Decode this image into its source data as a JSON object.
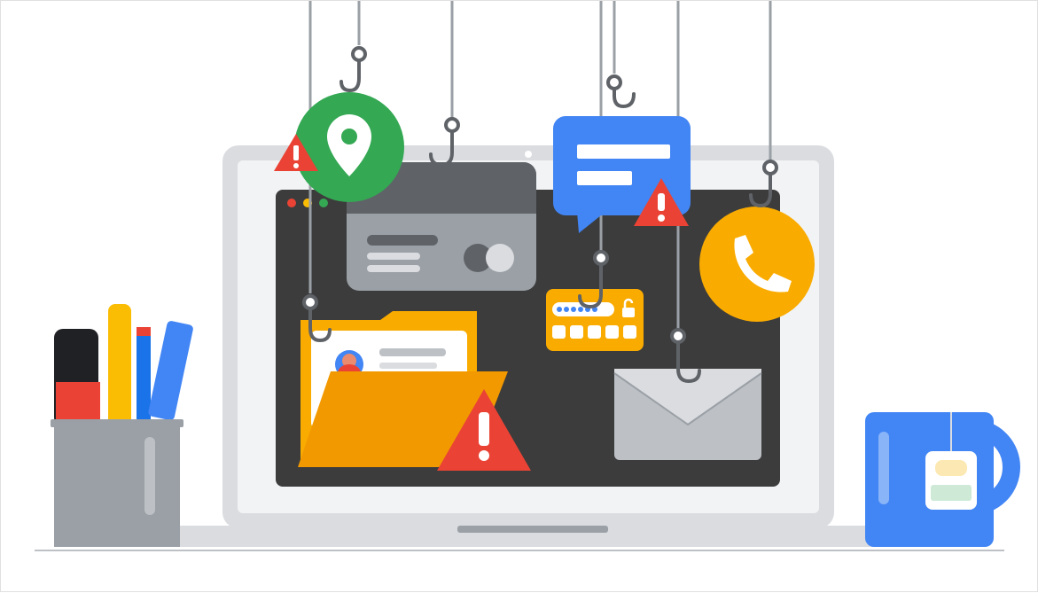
{
  "illustration": {
    "subject": "phishing-hooks-on-laptop",
    "icons": [
      "location-pin-icon",
      "credit-card-icon",
      "chat-message-icon",
      "phone-icon",
      "password-icon",
      "envelope-icon",
      "folder-icon",
      "warning-icon",
      "fishing-hook-icon",
      "pencil-cup-icon",
      "tea-mug-icon"
    ],
    "colors": {
      "green": "#34a853",
      "blue": "#4285f4",
      "yellow": "#f9ab00",
      "red": "#ea4335",
      "screen": "#3c3c3c",
      "laptop": "#dadce0",
      "line": "#9aa0a6"
    }
  }
}
